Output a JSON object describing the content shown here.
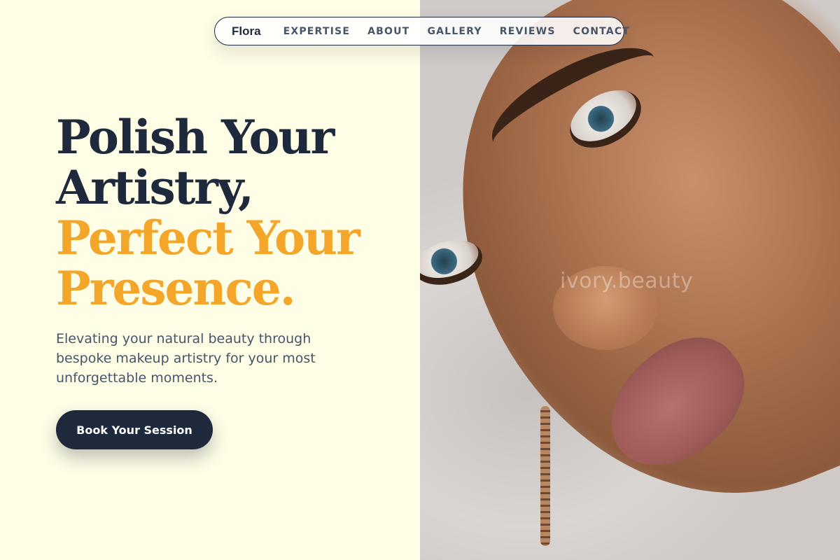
{
  "nav": {
    "brand": "Flora",
    "links": [
      "EXPERTISE",
      "ABOUT",
      "GALLERY",
      "REVIEWS",
      "CONTACT"
    ]
  },
  "hero": {
    "title_lines": [
      "Polish Your",
      "Artistry,"
    ],
    "accent_lines": [
      "Perfect Your",
      "Presence."
    ],
    "subtitle": "Elevating your natural beauty through bespoke makeup artistry for your most unforgettable moments.",
    "cta_label": "Book Your Session"
  },
  "image": {
    "watermark": "ivory.beauty"
  },
  "colors": {
    "background": "#fefde6",
    "primary_dark": "#1e293b",
    "accent": "#f4a62a",
    "body_text": "#475569"
  }
}
